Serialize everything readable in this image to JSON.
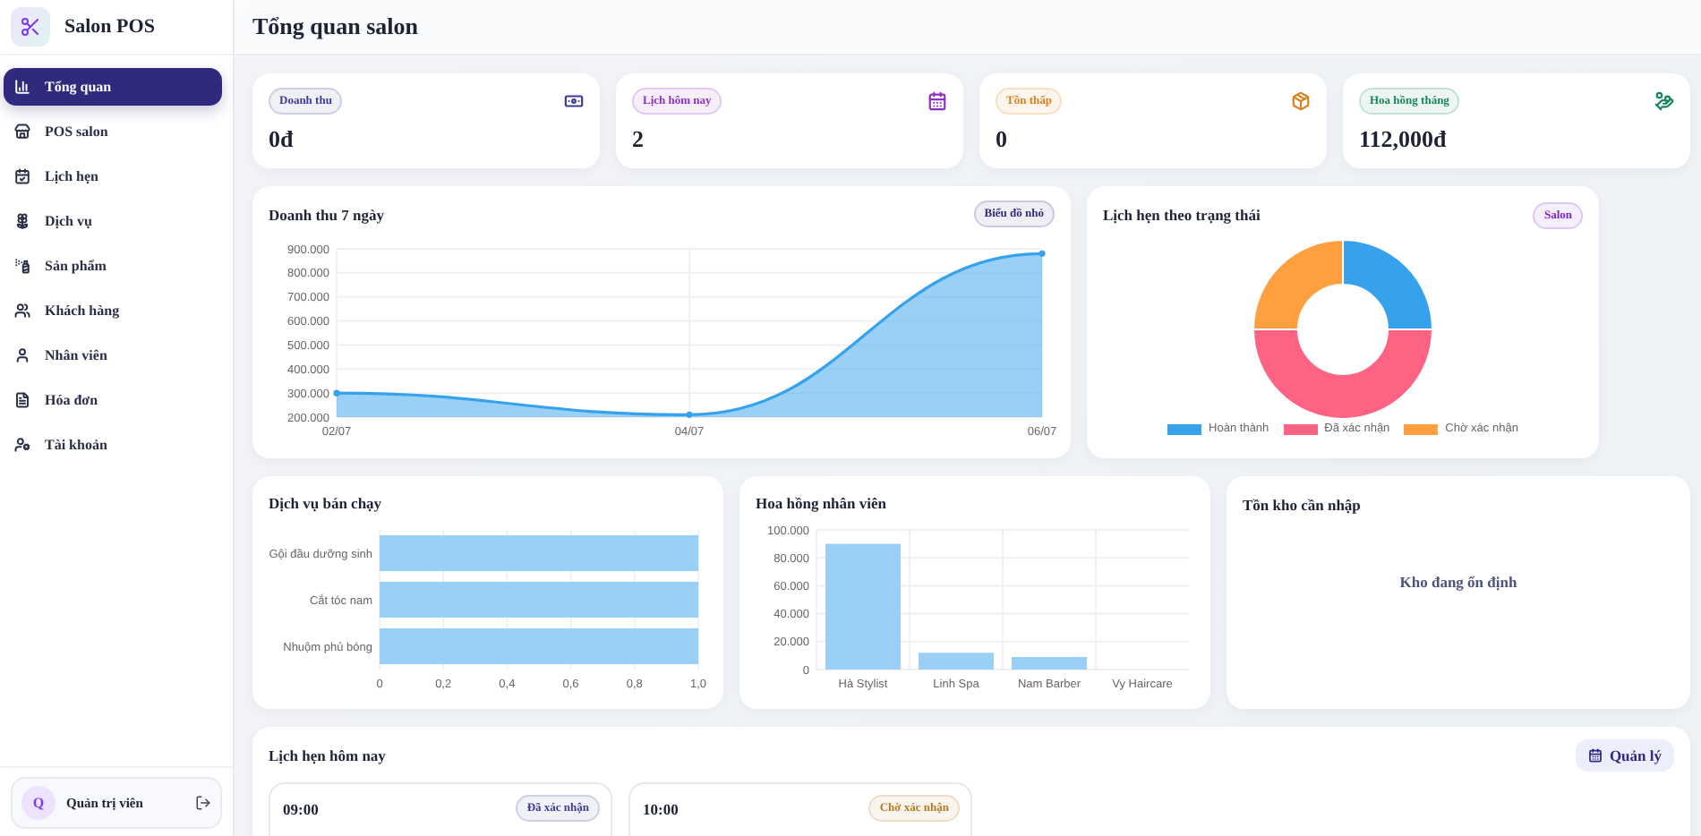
{
  "sidebar": {
    "brand": "Salon POS",
    "items": [
      {
        "label": "Tổng quan",
        "selected": true
      },
      {
        "label": "POS salon",
        "selected": false
      },
      {
        "label": "Lịch hẹn",
        "selected": false
      },
      {
        "label": "Dịch vụ",
        "selected": false
      },
      {
        "label": "Sản phẩm",
        "selected": false
      },
      {
        "label": "Khách hàng",
        "selected": false
      },
      {
        "label": "Nhân viên",
        "selected": false
      },
      {
        "label": "Hóa đơn",
        "selected": false
      },
      {
        "label": "Tài khoản",
        "selected": false
      }
    ],
    "user": {
      "avatar": "Q",
      "name": "Quản trị viên"
    }
  },
  "header": {
    "title": "Tổng quan salon"
  },
  "stats": [
    {
      "label": "Doanh thu",
      "value": "0đ",
      "color": "#3b3b98"
    },
    {
      "label": "Lịch hôm nay",
      "value": "2",
      "color": "#8e2fc4"
    },
    {
      "label": "Tồn thấp",
      "value": "0",
      "color": "#d9821a"
    },
    {
      "label": "Hoa hồng tháng",
      "value": "112,000đ",
      "color": "#17875a"
    }
  ],
  "revenue": {
    "title": "Doanh thu 7 ngày",
    "badge": "Biểu đồ nhỏ",
    "chart_data": {
      "type": "area",
      "grid": true,
      "categories": [
        "02/07",
        "04/07",
        "06/07"
      ],
      "series": [
        {
          "color": "#36a2eb",
          "values": [
            300000,
            210000,
            880000
          ]
        }
      ],
      "ylim": [
        200000,
        900000
      ],
      "yticks": [
        {
          "value": 200000,
          "label": "200.000"
        },
        {
          "value": 300000,
          "label": "300.000"
        },
        {
          "value": 400000,
          "label": "400.000"
        },
        {
          "value": 500000,
          "label": "500.000"
        },
        {
          "value": 600000,
          "label": "600.000"
        },
        {
          "value": 700000,
          "label": "700.000"
        },
        {
          "value": 800000,
          "label": "800.000"
        },
        {
          "value": 900000,
          "label": "900.000"
        }
      ]
    }
  },
  "status": {
    "title": "Lịch hẹn theo trạng thái",
    "badge": "Salon",
    "chart_data": {
      "type": "donut",
      "categories": [
        "Hoàn thành",
        "Đã xác nhận",
        "Chờ xác nhận"
      ],
      "colors": [
        "#36a2eb",
        "#ff6384",
        "#ff9f40"
      ],
      "series": [
        {
          "values": [
            25,
            50,
            25
          ]
        }
      ]
    }
  },
  "services": {
    "title": "Dịch vụ bán chạy",
    "chart_data": {
      "type": "bar",
      "orientation": "horizontal",
      "grid": true,
      "categories": [
        "Gội đầu dưỡng sinh",
        "Cắt tóc nam",
        "Nhuộm phủ bóng"
      ],
      "series": [
        {
          "color": "#9ad0f5",
          "values": [
            1,
            1,
            1
          ]
        }
      ],
      "xlim": [
        0,
        1
      ],
      "xticks": [
        {
          "value": 0,
          "label": "0"
        },
        {
          "value": 0.2,
          "label": "0,2"
        },
        {
          "value": 0.4,
          "label": "0,4"
        },
        {
          "value": 0.6,
          "label": "0,6"
        },
        {
          "value": 0.8,
          "label": "0,8"
        },
        {
          "value": 1,
          "label": "1,0"
        }
      ]
    }
  },
  "commission": {
    "title": "Hoa hồng nhân viên",
    "chart_data": {
      "type": "bar",
      "orientation": "vertical",
      "grid": true,
      "categories": [
        "Hà Stylist",
        "Linh Spa",
        "Nam Barber",
        "Vy Haircare"
      ],
      "series": [
        {
          "color": "#9ad0f5",
          "values": [
            90000,
            12000,
            9000,
            0
          ]
        }
      ],
      "ylim": [
        0,
        100000
      ],
      "yticks": [
        {
          "value": 0,
          "label": "0"
        },
        {
          "value": 20000,
          "label": "20.000"
        },
        {
          "value": 40000,
          "label": "40.000"
        },
        {
          "value": 60000,
          "label": "60.000"
        },
        {
          "value": 80000,
          "label": "80.000"
        },
        {
          "value": 100000,
          "label": "100.000"
        }
      ]
    }
  },
  "stock": {
    "title": "Tồn kho cần nhập",
    "message": "Kho đang ổn định"
  },
  "today": {
    "title": "Lịch hẹn hôm nay",
    "button": "Quản lý",
    "items": [
      {
        "time": "09:00",
        "status": "Đã xác nhận",
        "color": "#3b3b98"
      },
      {
        "time": "10:00",
        "status": "Chờ xác nhận",
        "color": "#b7791f"
      }
    ]
  }
}
